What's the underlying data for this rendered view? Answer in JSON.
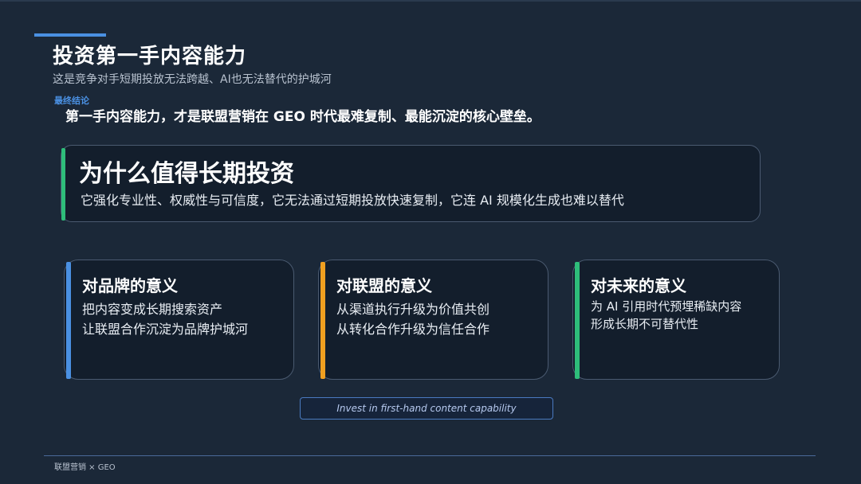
{
  "slide": {
    "title": "投资第一手内容能力",
    "subtitle": "这是竞争对手短期投放无法跨越、AI也无法替代的护城河",
    "final_label": "最终结论",
    "final_text": "第一手内容能力，才是联盟营销在 GEO 时代最难复制、最能沉淀的核心壁垒。"
  },
  "main_card": {
    "heading": "为什么值得长期投资",
    "body": "它强化专业性、权威性与可信度，它无法通过短期投放快速复制，它连 AI 规模化生成也难以替代",
    "accent_color": "#2ebd7a"
  },
  "cards": [
    {
      "heading": "对品牌的意义",
      "lines": [
        "把内容变成长期搜索资产",
        "让联盟合作沉淀为品牌护城河"
      ],
      "accent_color": "#4a90e2"
    },
    {
      "heading": "对联盟的意义",
      "lines": [
        "从渠道执行升级为价值共创",
        "从转化合作升级为信任合作"
      ],
      "accent_color": "#f0a020"
    },
    {
      "heading": "对未来的意义",
      "lines": [
        "为 AI 引用时代预埋稀缺内容",
        "形成长期不可替代性"
      ],
      "accent_color": "#2ebd7a"
    }
  ],
  "tagline": "Invest in first-hand content capability",
  "footer": "联盟营销 × GEO"
}
